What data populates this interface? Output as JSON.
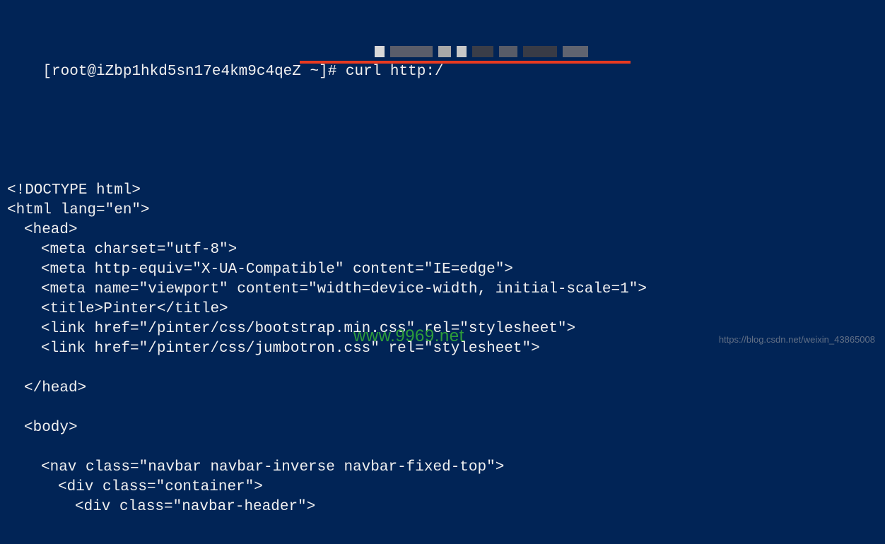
{
  "prompt": {
    "user_host": "[root@iZbp1hkd5sn17e4km9c4qeZ ~]#",
    "command": "curl http:/"
  },
  "output": {
    "lines": [
      {
        "indent": 0,
        "text": "<!DOCTYPE html>"
      },
      {
        "indent": 0,
        "text": "<html lang=\"en\">"
      },
      {
        "indent": 1,
        "text": "<head>"
      },
      {
        "indent": 2,
        "text": "<meta charset=\"utf-8\">"
      },
      {
        "indent": 2,
        "text": "<meta http-equiv=\"X-UA-Compatible\" content=\"IE=edge\">"
      },
      {
        "indent": 2,
        "text": "<meta name=\"viewport\" content=\"width=device-width, initial-scale=1\">"
      },
      {
        "indent": 2,
        "text": "<title>Pinter</title>"
      },
      {
        "indent": 2,
        "text": "<link href=\"/pinter/css/bootstrap.min.css\" rel=\"stylesheet\">"
      },
      {
        "indent": 2,
        "text": "<link href=\"/pinter/css/jumbotron.css\" rel=\"stylesheet\">"
      },
      {
        "indent": 0,
        "text": ""
      },
      {
        "indent": 1,
        "text": "</head>"
      },
      {
        "indent": 0,
        "text": ""
      },
      {
        "indent": 1,
        "text": "<body>"
      },
      {
        "indent": 0,
        "text": ""
      },
      {
        "indent": 2,
        "text": "<nav class=\"navbar navbar-inverse navbar-fixed-top\">"
      },
      {
        "indent": 3,
        "text": "<div class=\"container\">"
      },
      {
        "indent": 4,
        "text": "<div class=\"navbar-header\">"
      }
    ]
  },
  "watermarks": {
    "green": "www.9969.net",
    "grey": "https://blog.csdn.net/weixin_43865008"
  }
}
